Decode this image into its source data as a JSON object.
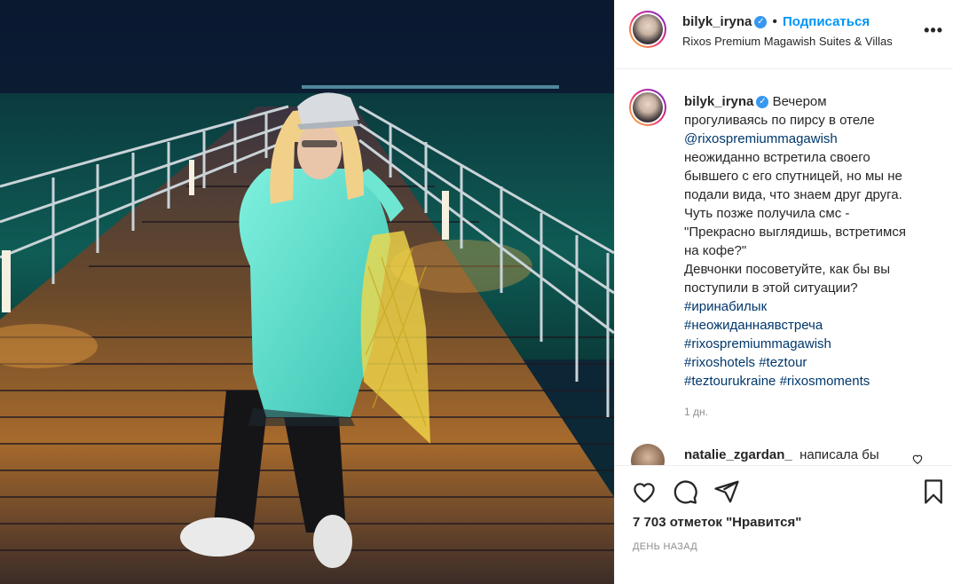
{
  "post": {
    "username": "bilyk_iryna",
    "verified_mark": "✓",
    "separator": "•",
    "follow_label": "Подписаться",
    "location": "Rixos Premium Magawish Suites & Villas",
    "more_label": "•••",
    "caption_lines": [
      "Вечером",
      "прогуливаясь по пирсу в отеле"
    ],
    "caption_mention": "@rixospremiummagawish",
    "caption_body": [
      "неожиданно встретила своего",
      "бывшего с его спутницей, но мы не",
      "подали вида, что знаем друг друга.",
      "Чуть позже получила смс -",
      "\"Прекрасно выглядишь, встретимся",
      "на кофе?\"",
      "Девчонки посоветуйте, как бы вы",
      "поступили в этой ситуации?"
    ],
    "hashtags": [
      "#иринабилык",
      "#неожиданнаявстреча",
      "#rixospremiummagawish",
      "#rixoshotels #teztour",
      "#teztourukraine #rixosmoments"
    ],
    "time_ago": "1 дн.",
    "comment": {
      "username": "natalie_zgardan_",
      "text": "написала бы"
    },
    "likes_text": "7 703 отметок \"Нравится\"",
    "date_text": "ДЕНЬ НАЗАД",
    "colors": {
      "accent": "#0095f6",
      "text": "#262626",
      "hashtag": "#00376b",
      "muted": "#8e8e8e"
    },
    "icons": [
      "heart-icon",
      "comment-icon",
      "share-icon",
      "bookmark-icon",
      "more-icon",
      "verified-icon"
    ]
  }
}
